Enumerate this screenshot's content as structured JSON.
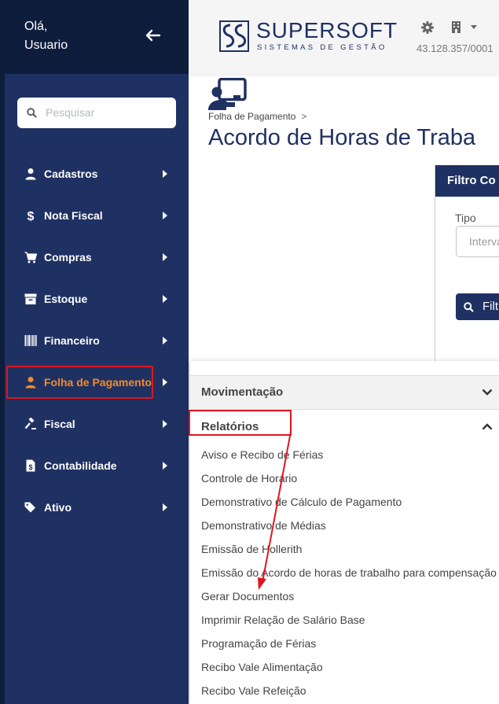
{
  "user": {
    "greeting_line1": "Olá,",
    "greeting_line2": "Usuario"
  },
  "search": {
    "placeholder": "Pesquisar"
  },
  "sidebar": {
    "items": [
      {
        "label": "Cadastros",
        "icon": "user-icon"
      },
      {
        "label": "Nota Fiscal",
        "icon": "dollar-icon"
      },
      {
        "label": "Compras",
        "icon": "cart-icon"
      },
      {
        "label": "Estoque",
        "icon": "archive-box-icon"
      },
      {
        "label": "Financeiro",
        "icon": "barcode-icon"
      },
      {
        "label": "Folha de Pagamento",
        "icon": "user-icon",
        "active": true
      },
      {
        "label": "Fiscal",
        "icon": "gavel-icon"
      },
      {
        "label": "Contabilidade",
        "icon": "file-dollar-icon"
      },
      {
        "label": "Ativo",
        "icon": "tags-icon"
      }
    ]
  },
  "header": {
    "brand": "SUPERSOFT",
    "brand_subtitle": "SISTEMAS DE GESTÃO",
    "cnpj": "43.128.357/0001"
  },
  "breadcrumb": {
    "item": "Folha de Pagamento",
    "separator": ">"
  },
  "page": {
    "title": "Acordo de Horas de Traba"
  },
  "filter": {
    "title": "Filtro Co",
    "tipo_label": "Tipo",
    "tipo_value": "Interva",
    "button_label": "Filtr"
  },
  "dropdown": {
    "sections": [
      {
        "label": "Movimentação",
        "expanded": false
      },
      {
        "label": "Relatórios",
        "expanded": true
      }
    ],
    "report_items": [
      "Aviso e Recibo de Férias",
      "Controle de Horário",
      "Demonstrativo de Cálculo de Pagamento",
      "Demonstrativo de Médias",
      "Emissão de Hollerith",
      "Emissão do Acordo de horas de trabalho para compensação",
      "Gerar Documentos",
      "Imprimir Relação de Salário Base",
      "Programação de Férias",
      "Recibo Vale Alimentação",
      "Recibo Vale Refeição"
    ]
  },
  "colors": {
    "sidebar_dark": "#0f1d3d",
    "sidebar": "#1f3162",
    "active_item": "#f28c28",
    "annotation_red": "#e0151f"
  }
}
